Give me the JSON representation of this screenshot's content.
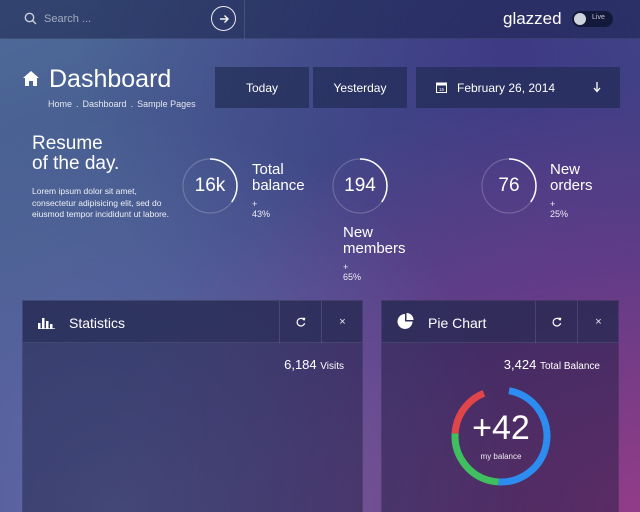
{
  "topbar": {
    "search_placeholder": "Search ...",
    "brand": "glazzed",
    "toggle_label": "Live"
  },
  "header": {
    "title": "Dashboard",
    "breadcrumbs": [
      "Home",
      "Dashboard",
      "Sample Pages"
    ],
    "buttons": {
      "today": "Today",
      "yesterday": "Yesterday"
    },
    "date": "February 26, 2014",
    "date_icon_day": "15"
  },
  "resume": {
    "title_line1": "Resume",
    "title_line2": "of the day.",
    "text": "Lorem ipsum dolor sit amet, consectetur adipisicing elit, sed do eiusmod tempor incididunt ut labore."
  },
  "stats": [
    {
      "value": "16k",
      "label_line1": "Total",
      "label_line2": "balance",
      "delta": "+ 43%",
      "progress": 0.35
    },
    {
      "value": "194",
      "label_line1": "New",
      "label_line2": "members",
      "delta": "+ 65%",
      "progress": 0.35
    },
    {
      "value": "76",
      "label_line1": "New",
      "label_line2": "orders",
      "delta": "+ 25%",
      "progress": 0.35
    }
  ],
  "panels": {
    "statistics": {
      "title": "Statistics",
      "value": "6,184",
      "unit": "Visits",
      "refresh_icon": "refresh-icon",
      "close_label": "×"
    },
    "pie": {
      "title": "Pie Chart",
      "value": "3,424",
      "unit": "Total Balance",
      "center_value": "+42",
      "center_label": "my balance",
      "close_label": "×"
    }
  },
  "pie_segments": [
    {
      "name": "blue",
      "color": "#2d8cf0",
      "fraction": 0.48
    },
    {
      "name": "green",
      "color": "#3fbf5f",
      "fraction": 0.25
    },
    {
      "name": "red",
      "color": "#e0454a",
      "fraction": 0.18
    },
    {
      "name": "gap",
      "color": "rgba(255,255,255,0)",
      "fraction": 0.09
    }
  ]
}
